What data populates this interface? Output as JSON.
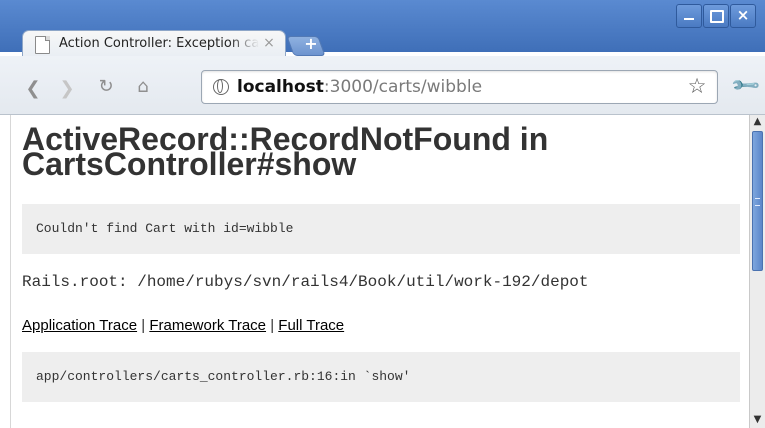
{
  "window": {
    "tab_title": "Action Controller: Exception caught",
    "tab_close_glyph": "×",
    "new_tab_glyph": "+",
    "controls": {
      "minimize": "",
      "maximize": "",
      "close": "×"
    }
  },
  "toolbar": {
    "back_glyph": "❮",
    "forward_glyph": "❯",
    "reload_glyph": "↻",
    "home_glyph": "⌂",
    "url_host": "localhost",
    "url_rest": ":3000/carts/wibble",
    "star_glyph": "☆",
    "wrench_glyph": "🔧"
  },
  "page": {
    "heading": "ActiveRecord::RecordNotFound in CartsController#show",
    "error_message": "Couldn't find Cart with id=wibble",
    "rails_root": "Rails.root: /home/rubys/svn/rails4/Book/util/work-192/depot",
    "trace_links": {
      "application": "Application Trace",
      "framework": "Framework Trace",
      "full": "Full Trace",
      "separator": "|"
    },
    "trace_line": "app/controllers/carts_controller.rb:16:in `show'"
  },
  "scrollbar": {
    "up_glyph": "▲",
    "down_glyph": "▼",
    "position": 0
  }
}
